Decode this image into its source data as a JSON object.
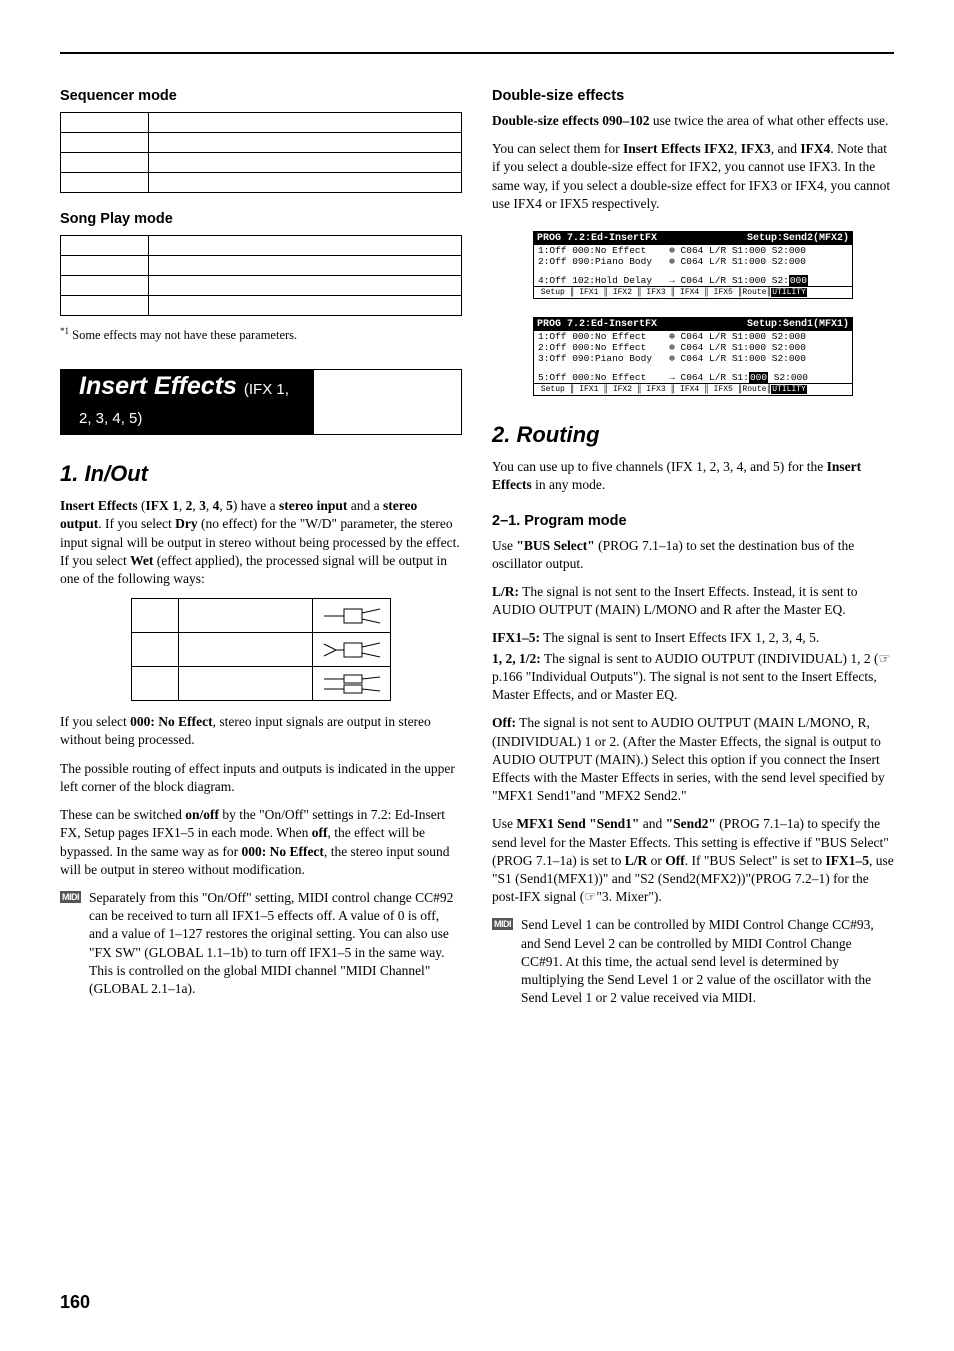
{
  "page_number": "160",
  "left": {
    "h_seq": "Sequencer mode",
    "h_song": "Song Play mode",
    "footnote_sup": "*1",
    "footnote": " Some effects may not have these parameters.",
    "banner_main": "Insert Effects ",
    "banner_sub": "(IFX 1, 2, 3, 4, 5)",
    "h_inout": "1. In/Out",
    "p1a": "Insert Effects",
    "p1b": " (",
    "p1c": "IFX 1",
    "p1d": ", ",
    "p1e": "2",
    "p1f": "3",
    "p1g": "4",
    "p1h": "5",
    "p1i": ") have a ",
    "p1j": "stereo input",
    "p1k": " and a ",
    "p1l": "stereo output",
    "p1m": ". If you select ",
    "p1n": "Dry",
    "p1o": " (no effect) for the \"W/D\" parameter, the stereo input signal will be output in stereo without being processed by the effect. If you select ",
    "p1p": "Wet",
    "p1q": " (effect applied), the processed signal will be output in one of the following ways:",
    "p2a": "If you select ",
    "p2b": "000: No Effect",
    "p2c": ", stereo input signals are output in stereo without being processed.",
    "p3": "The possible routing of effect inputs and outputs is indicated in the upper left corner of the block diagram.",
    "p4a": "These can be switched ",
    "p4b": "on/off",
    "p4c": " by the \"On/Off\" settings in 7.2: Ed-Insert FX, Setup pages IFX1–5 in each mode. When ",
    "p4d": "off",
    "p4e": ", the effect will be bypassed. In the same way as for ",
    "p4f": "000: No Effect",
    "p4g": ", the stereo input sound will be output in stereo without modification.",
    "midi1": "Separately from this \"On/Off\" setting, MIDI control change CC#92 can be received to turn all IFX1–5 effects off. A value of 0 is off, and a value of 1–127 restores the original setting. You can also use \"FX SW\" (GLOBAL 1.1–1b) to turn off IFX1–5 in the same way. This is controlled on the global MIDI channel \"MIDI Channel\" (GLOBAL 2.1–1a).",
    "midi_tag": "MIDI"
  },
  "right": {
    "h_dbl": "Double-size effects",
    "p1a": "Double-size effects 090–102",
    "p1b": " use twice the area of what other effects use.",
    "p2a": "You can select them for ",
    "p2b": "Insert Effects IFX2",
    "p2c": ", ",
    "p2d": "IFX3",
    "p2e": ", and ",
    "p2f": "IFX4",
    "p2g": ". Note that if you select a double-size effect for IFX2, you cannot use IFX3. In the same way, if you select a double-size effect for IFX3 or IFX4, you cannot use IFX4 or IFX5 respectively.",
    "lcd1": {
      "title_l": "PROG 7.2:Ed-InsertFX",
      "title_r": "Setup:Send2(MFX2)",
      "r1": "1:Off 000:No Effect    ⊕ C064 L/R S1:000 S2:000",
      "r2": "2:Off 090:Piano Body   ⊕ C064 L/R S1:000 S2:000",
      "r3": "4:Off 102:Hold Delay   → C064 L/R S1:000 S2:",
      "r3_inv": "000",
      "tabs": " Setup ║ IFX1 ║ IFX2 ║ IFX3 ║ IFX4 ║ IFX5 ║Route║",
      "tabs_end": "UTILITY"
    },
    "lcd2": {
      "title_l": "PROG 7.2:Ed-InsertFX",
      "title_r": "Setup:Send1(MFX1)",
      "r1": "1:Off 000:No Effect    ⊕ C064 L/R S1:000 S2:000",
      "r2": "2:Off 000:No Effect    ⊕ C064 L/R S1:000 S2:000",
      "r3": "3:Off 090:Piano Body   ⊕ C064 L/R S1:000 S2:000",
      "r4": "5:Off 000:No Effect    → C064 L/R S1:",
      "r4_inv": "000",
      "r4b": " S2:000",
      "tabs": " Setup ║ IFX1 ║ IFX2 ║ IFX3 ║ IFX4 ║ IFX5 ║Route║",
      "tabs_end": "UTILITY"
    },
    "h_routing": "2. Routing",
    "p3": "You can use up to five channels (IFX 1, 2, 3, 4, and 5) for the ",
    "p3b": "Insert Effects",
    "p3c": " in any mode.",
    "h_21": "2–1. Program mode",
    "p4a": "Use ",
    "p4b": "\"BUS Select\"",
    "p4c": " (PROG 7.1–1a) to set the destination bus of the oscillator output.",
    "p5a": "L/R:",
    "p5b": " The signal is not sent to the Insert Effects. Instead, it is sent to AUDIO OUTPUT (MAIN) L/MONO and R after the Master EQ.",
    "p6a": "IFX1–5:",
    "p6b": " The signal is sent to Insert Effects IFX 1, 2, 3, 4, 5.",
    "p7a": "1, 2, 1/2:",
    "p7b": " The signal is sent to AUDIO OUTPUT (INDIVIDUAL) 1, 2 (☞p.166 \"Individual Outputs\"). The signal is not sent to the Insert Effects, Master Effects, and or Master EQ.",
    "p8a": "Off:",
    "p8b": " The signal is not sent to AUDIO OUTPUT (MAIN L/MONO, R, (INDIVIDUAL) 1 or 2. (After the Master Effects, the signal is output to AUDIO OUTPUT (MAIN).) Select this option if you connect the Insert Effects with the Master Effects in series, with the send level specified by \"MFX1 Send1\"and \"MFX2 Send2.\"",
    "p9a": "Use ",
    "p9b": "MFX1 Send \"Send1\"",
    "p9c": " and ",
    "p9d": "\"Send2\"",
    "p9e": " (PROG 7.1–1a) to specify the send level for the Master Effects. This setting is effective if \"BUS Select\" (PROG 7.1–1a) is set to ",
    "p9f": "L/R",
    "p9g": " or ",
    "p9h": "Off",
    "p9i": ". If \"BUS Select\" is set to ",
    "p9j": "IFX1–5",
    "p9k": ", use \"S1 (Send1(MFX1))\" and \"S2 (Send2(MFX2))\"(PROG 7.2–1) for the post-IFX signal (☞\"3. Mixer\").",
    "midi2": "Send Level 1 can be controlled by MIDI Control Change CC#93, and Send Level 2 can be controlled by MIDI Control Change CC#91. At this time, the actual send level is determined by multiplying the Send Level 1 or 2 value of the oscillator with the Send Level 1 or 2 value received via MIDI."
  }
}
